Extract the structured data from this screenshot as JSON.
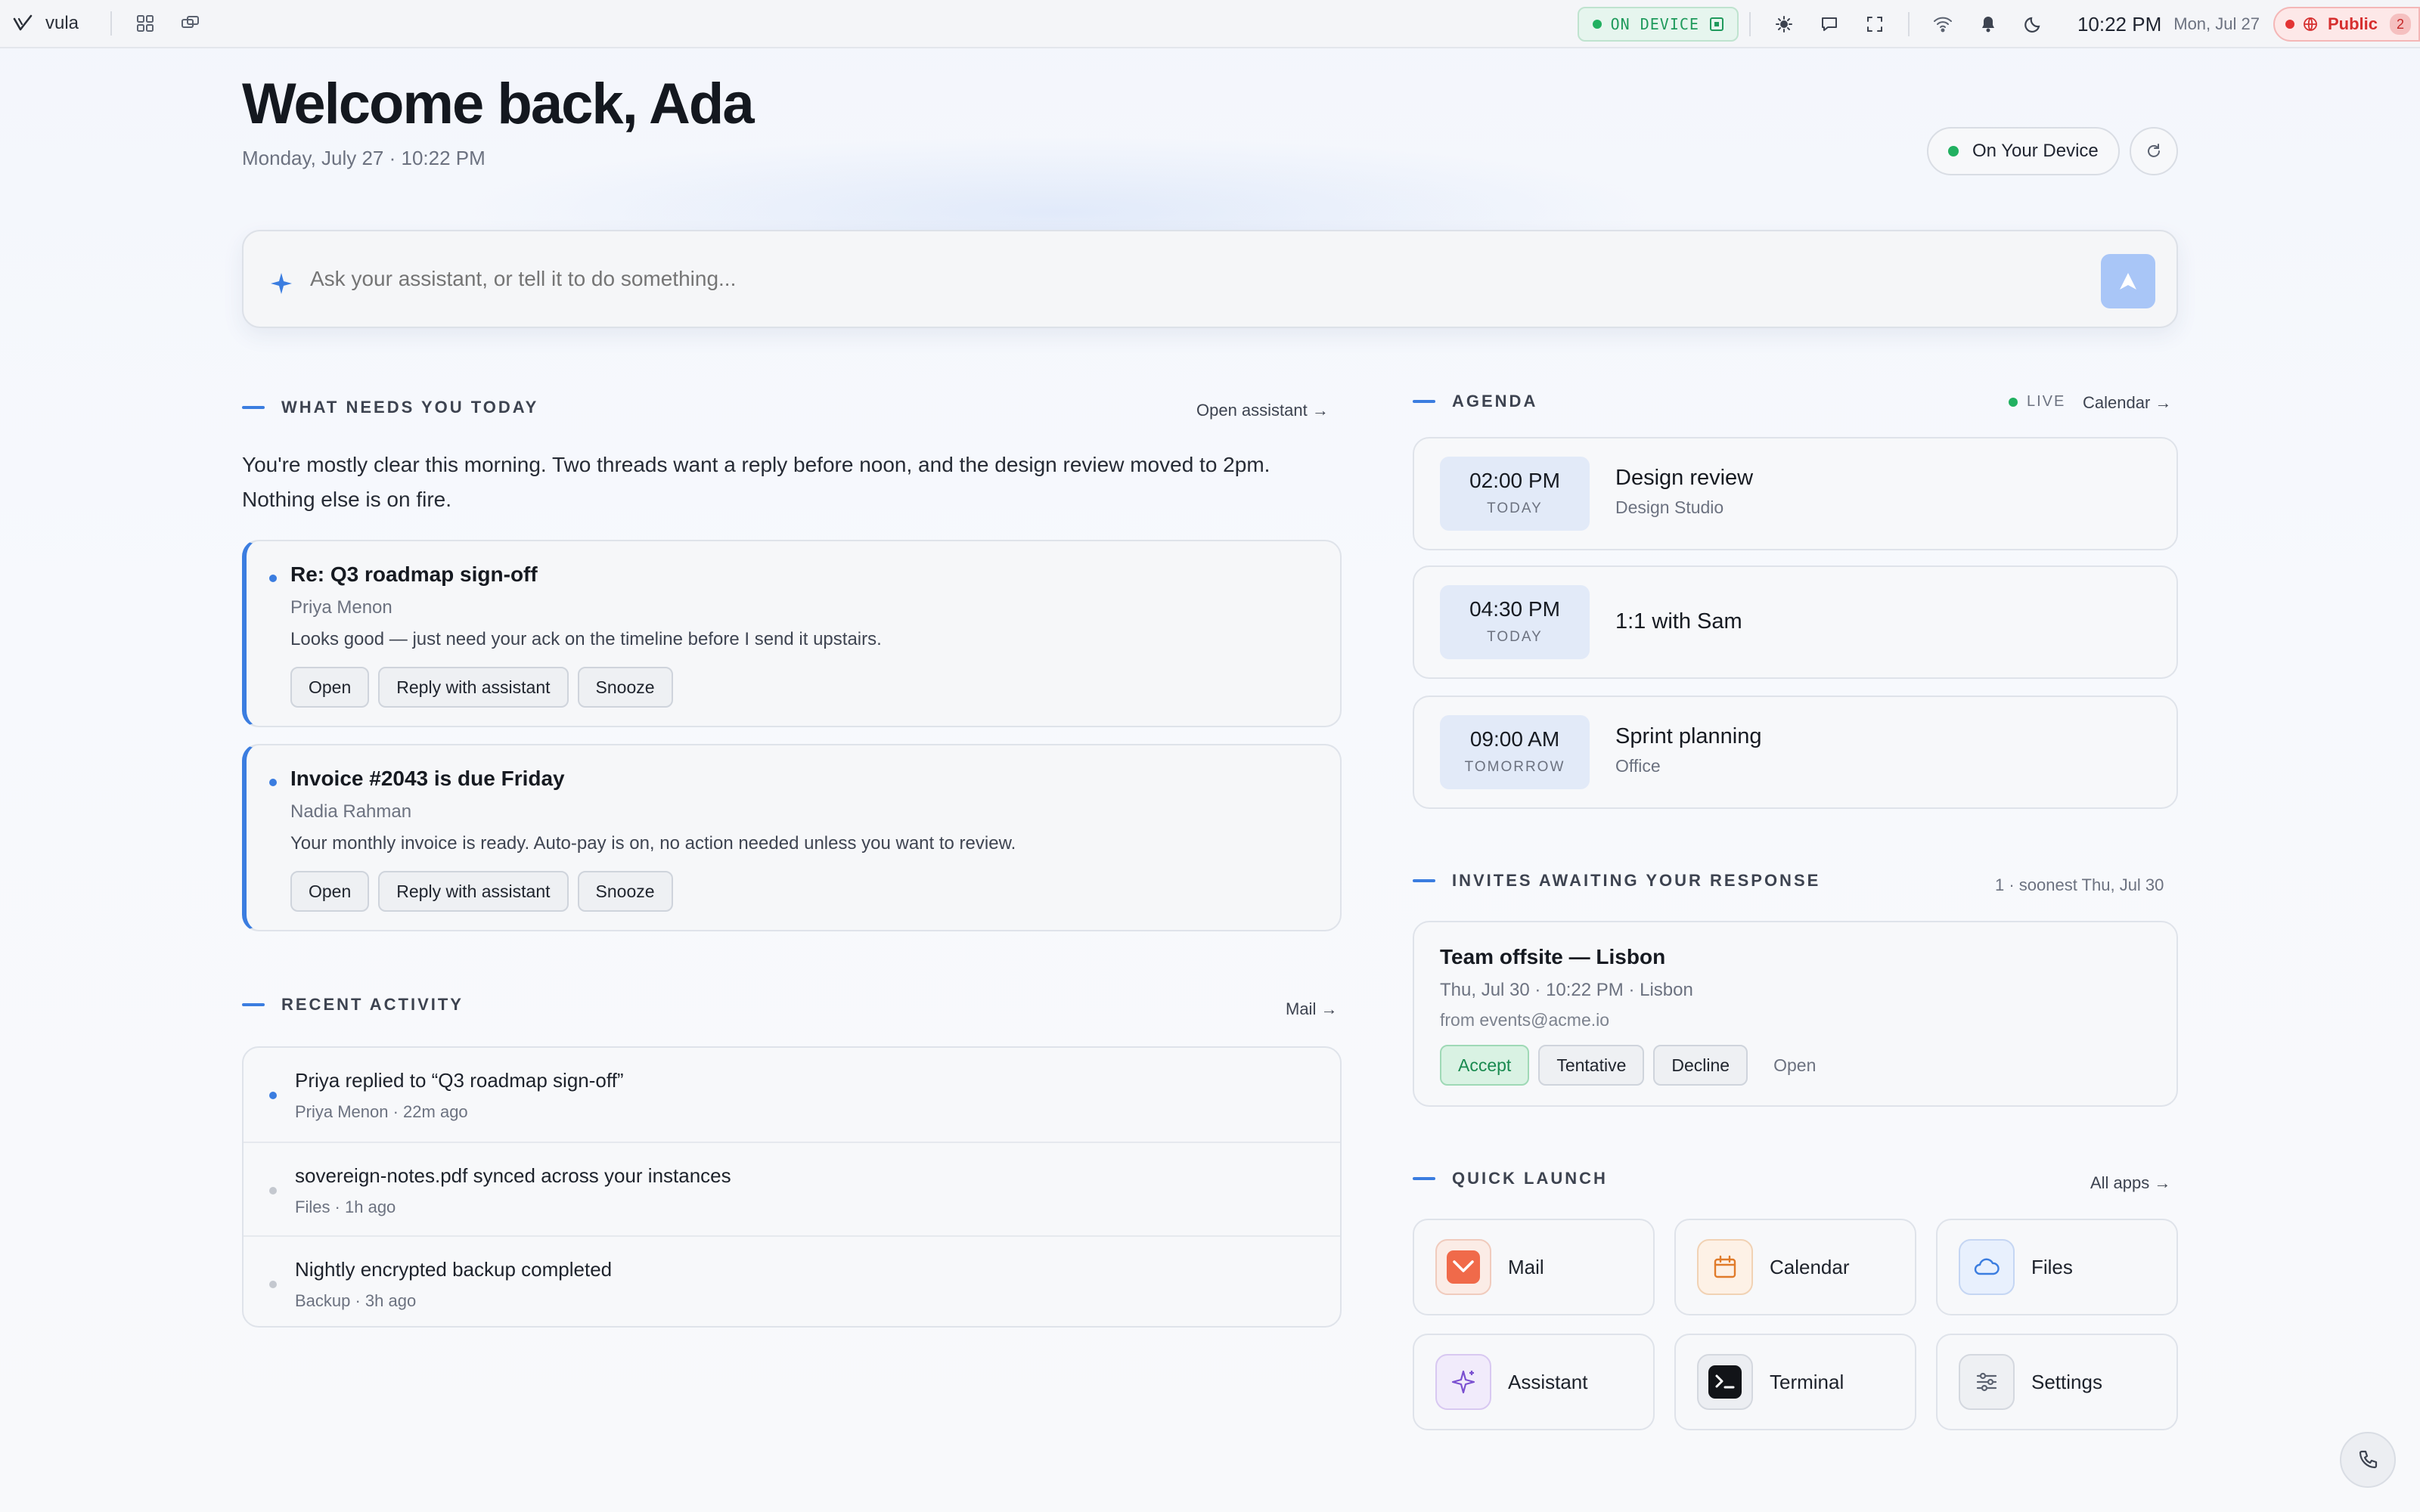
{
  "topbar": {
    "brand": "vula",
    "status_label": "ON DEVICE",
    "time": "10:22 PM",
    "date": "Mon, Jul 27",
    "visibility_label": "Public",
    "visibility_count": "2",
    "colors": {
      "online": "#21b060",
      "public": "#d62f2f"
    }
  },
  "hero": {
    "greeting": "Welcome back, Ada",
    "datetime": "Monday, July 27 · 10:22 PM",
    "device_button": "On Your Device"
  },
  "ask": {
    "placeholder": "Ask your assistant, or tell it to do something..."
  },
  "needs": {
    "heading": "WHAT NEEDS YOU TODAY",
    "link": "Open assistant →",
    "summary": "You're mostly clear this morning. Two threads want a reply before noon, and the design review moved to 2pm. Nothing else is on fire.",
    "items": [
      {
        "title": "Re: Q3 roadmap sign-off",
        "from": "Priya Menon",
        "body": "Looks good — just need your ack on the timeline before I send it upstairs.",
        "actions": [
          "Open",
          "Reply with assistant",
          "Snooze"
        ]
      },
      {
        "title": "Invoice #2043 is due Friday",
        "from": "Nadia Rahman",
        "body": "Your monthly invoice is ready. Auto-pay is on, no action needed unless you want to review.",
        "actions": [
          "Open",
          "Reply with assistant",
          "Snooze"
        ]
      }
    ]
  },
  "activity": {
    "heading": "RECENT ACTIVITY",
    "link": "Mail →",
    "items": [
      {
        "title": "Priya replied to “Q3 roadmap sign-off”",
        "meta": "Priya Menon · 22m ago",
        "unread": true
      },
      {
        "title": "sovereign-notes.pdf synced across your instances",
        "meta": "Files · 1h ago",
        "unread": false
      },
      {
        "title": "Nightly encrypted backup completed",
        "meta": "Backup · 3h ago",
        "unread": false
      }
    ]
  },
  "agenda": {
    "heading": "AGENDA",
    "live_label": "LIVE",
    "link": "Calendar →",
    "events": [
      {
        "time": "02:00 PM",
        "day": "TODAY",
        "title": "Design review",
        "location": "Design Studio"
      },
      {
        "time": "04:30 PM",
        "day": "TODAY",
        "title": "1:1 with Sam",
        "location": ""
      },
      {
        "time": "09:00 AM",
        "day": "TOMORROW",
        "title": "Sprint planning",
        "location": "Office"
      }
    ]
  },
  "invites": {
    "heading": "INVITES AWAITING YOUR RESPONSE",
    "summary": "1 · soonest Thu, Jul 30",
    "items": [
      {
        "title": "Team offsite — Lisbon",
        "when": "Thu, Jul 30 · 10:22 PM · Lisbon",
        "from": "from events@acme.io",
        "accept": "Accept",
        "tentative": "Tentative",
        "decline": "Decline",
        "open": "Open"
      }
    ]
  },
  "quick_launch": {
    "heading": "QUICK LAUNCH",
    "link": "All apps →",
    "apps": [
      {
        "label": "Mail",
        "icon": "mail-icon"
      },
      {
        "label": "Calendar",
        "icon": "calendar-icon"
      },
      {
        "label": "Files",
        "icon": "cloud-icon"
      },
      {
        "label": "Assistant",
        "icon": "sparkle-icon"
      },
      {
        "label": "Terminal",
        "icon": "terminal-icon"
      },
      {
        "label": "Settings",
        "icon": "sliders-icon"
      }
    ]
  }
}
